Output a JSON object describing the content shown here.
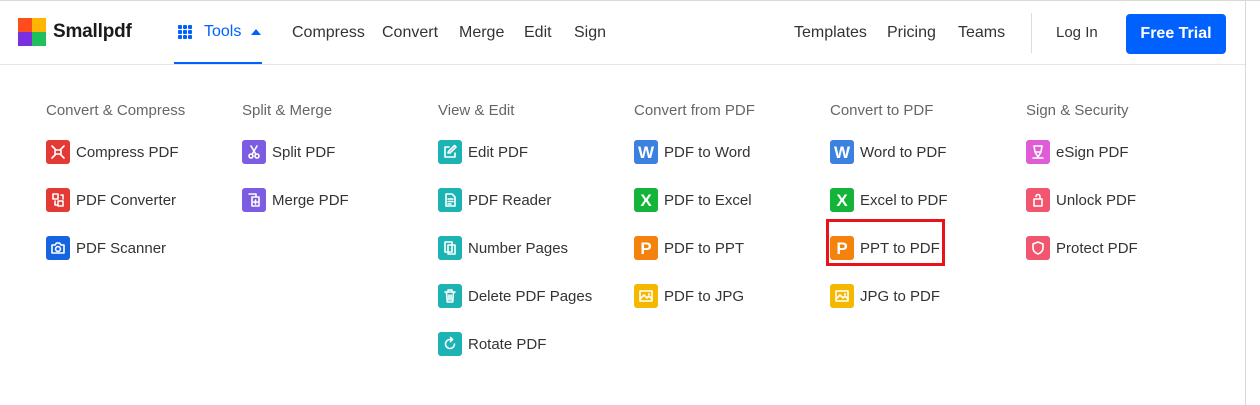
{
  "brand": {
    "name": "Smallpdf",
    "logo_colors": [
      "#ff4d1c",
      "#ffb400",
      "#7b2fe0",
      "#1fbf5b"
    ]
  },
  "header": {
    "tools_label": "Tools",
    "nav": [
      "Compress",
      "Convert",
      "Merge",
      "Edit",
      "Sign"
    ],
    "right_nav": [
      "Templates",
      "Pricing",
      "Teams"
    ],
    "login_label": "Log In",
    "trial_label": "Free Trial",
    "accent_color": "#0061fe"
  },
  "menu": {
    "columns": [
      {
        "title": "Convert & Compress",
        "items": [
          {
            "label": "Compress PDF",
            "icon": "compress-icon",
            "color": "#e53935"
          },
          {
            "label": "PDF Converter",
            "icon": "convert-icon",
            "color": "#e53935"
          },
          {
            "label": "PDF Scanner",
            "icon": "camera-icon",
            "color": "#1565e0"
          }
        ]
      },
      {
        "title": "Split & Merge",
        "items": [
          {
            "label": "Split PDF",
            "icon": "scissors-icon",
            "color": "#7c5ce0"
          },
          {
            "label": "Merge PDF",
            "icon": "merge-icon",
            "color": "#7c5ce0"
          }
        ]
      },
      {
        "title": "View & Edit",
        "items": [
          {
            "label": "Edit PDF",
            "icon": "edit-icon",
            "color": "#1bb3b3"
          },
          {
            "label": "PDF Reader",
            "icon": "reader-icon",
            "color": "#1bb3b3"
          },
          {
            "label": "Number Pages",
            "icon": "number-icon",
            "color": "#1bb3b3"
          },
          {
            "label": "Delete PDF Pages",
            "icon": "trash-icon",
            "color": "#1bb3b3"
          },
          {
            "label": "Rotate PDF",
            "icon": "rotate-icon",
            "color": "#1bb3b3"
          }
        ]
      },
      {
        "title": "Convert from PDF",
        "items": [
          {
            "label": "PDF to Word",
            "icon": "word-icon",
            "color": "#3b82e0",
            "glyph": "W"
          },
          {
            "label": "PDF to Excel",
            "icon": "excel-icon",
            "color": "#14b33a",
            "glyph": "X"
          },
          {
            "label": "PDF to PPT",
            "icon": "ppt-icon",
            "color": "#f5820d",
            "glyph": "P"
          },
          {
            "label": "PDF to JPG",
            "icon": "image-icon",
            "color": "#f5b800"
          }
        ]
      },
      {
        "title": "Convert to PDF",
        "items": [
          {
            "label": "Word to PDF",
            "icon": "word-icon",
            "color": "#3b82e0",
            "glyph": "W"
          },
          {
            "label": "Excel to PDF",
            "icon": "excel-icon",
            "color": "#14b33a",
            "glyph": "X"
          },
          {
            "label": "PPT to PDF",
            "icon": "ppt-icon",
            "color": "#f5820d",
            "glyph": "P",
            "highlighted": true
          },
          {
            "label": "JPG to PDF",
            "icon": "image-icon",
            "color": "#f5b800"
          }
        ]
      },
      {
        "title": "Sign & Security",
        "items": [
          {
            "label": "eSign PDF",
            "icon": "esign-icon",
            "color": "#e05cd6"
          },
          {
            "label": "Unlock PDF",
            "icon": "unlock-icon",
            "color": "#f2566e"
          },
          {
            "label": "Protect PDF",
            "icon": "shield-icon",
            "color": "#f2566e"
          }
        ]
      }
    ],
    "highlight_color": "#e8131a"
  }
}
